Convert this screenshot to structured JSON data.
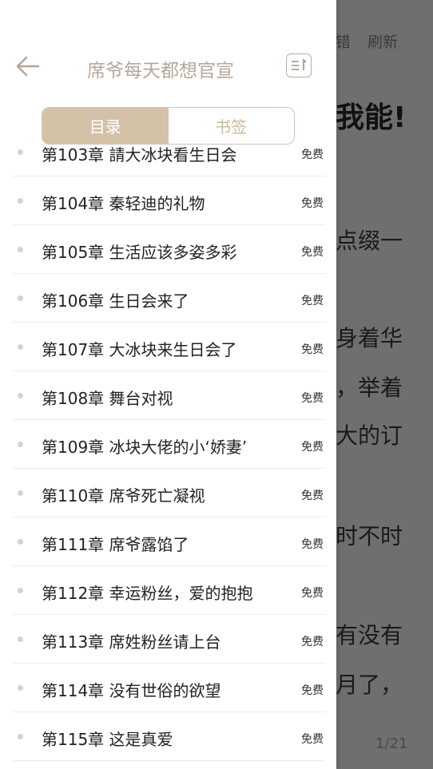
{
  "reader": {
    "top_left": "错",
    "top_right": "刷新",
    "title_fragment": "我能!",
    "lines": [
      "点缀一",
      "身着华",
      "，举着",
      "大的订",
      "时不时",
      "有没有",
      "月了，"
    ],
    "page_indicator": "1/21"
  },
  "drawer": {
    "book_title": "席爷每天都想官宣",
    "tabs": [
      "目录",
      "书签"
    ],
    "chapters": [
      {
        "title": "第103章 請大冰块看生日会",
        "tag": "免费"
      },
      {
        "title": "第104章 秦轻迪的礼物",
        "tag": "免费"
      },
      {
        "title": "第105章 生活应该多姿多彩",
        "tag": "免费"
      },
      {
        "title": "第106章 生日会来了",
        "tag": "免费"
      },
      {
        "title": "第107章 大冰块来生日会了",
        "tag": "免费"
      },
      {
        "title": "第108章 舞台对视",
        "tag": "免费"
      },
      {
        "title": "第109章 冰块大佬的小‘娇妻’",
        "tag": "免费"
      },
      {
        "title": "第110章 席爷死亡凝视",
        "tag": "免费"
      },
      {
        "title": "第111章 席爷露馅了",
        "tag": "免费"
      },
      {
        "title": "第112章 幸运粉丝，爱的抱抱",
        "tag": "免费"
      },
      {
        "title": "第113章 席姓粉丝请上台",
        "tag": "免费"
      },
      {
        "title": "第114章 没有世俗的欲望",
        "tag": "免费"
      },
      {
        "title": "第115章 这是真爱",
        "tag": "免费"
      }
    ]
  },
  "colors": {
    "accent": "#d4c2a8",
    "title": "#b5a89a",
    "overlay": "#6f6f6f"
  }
}
